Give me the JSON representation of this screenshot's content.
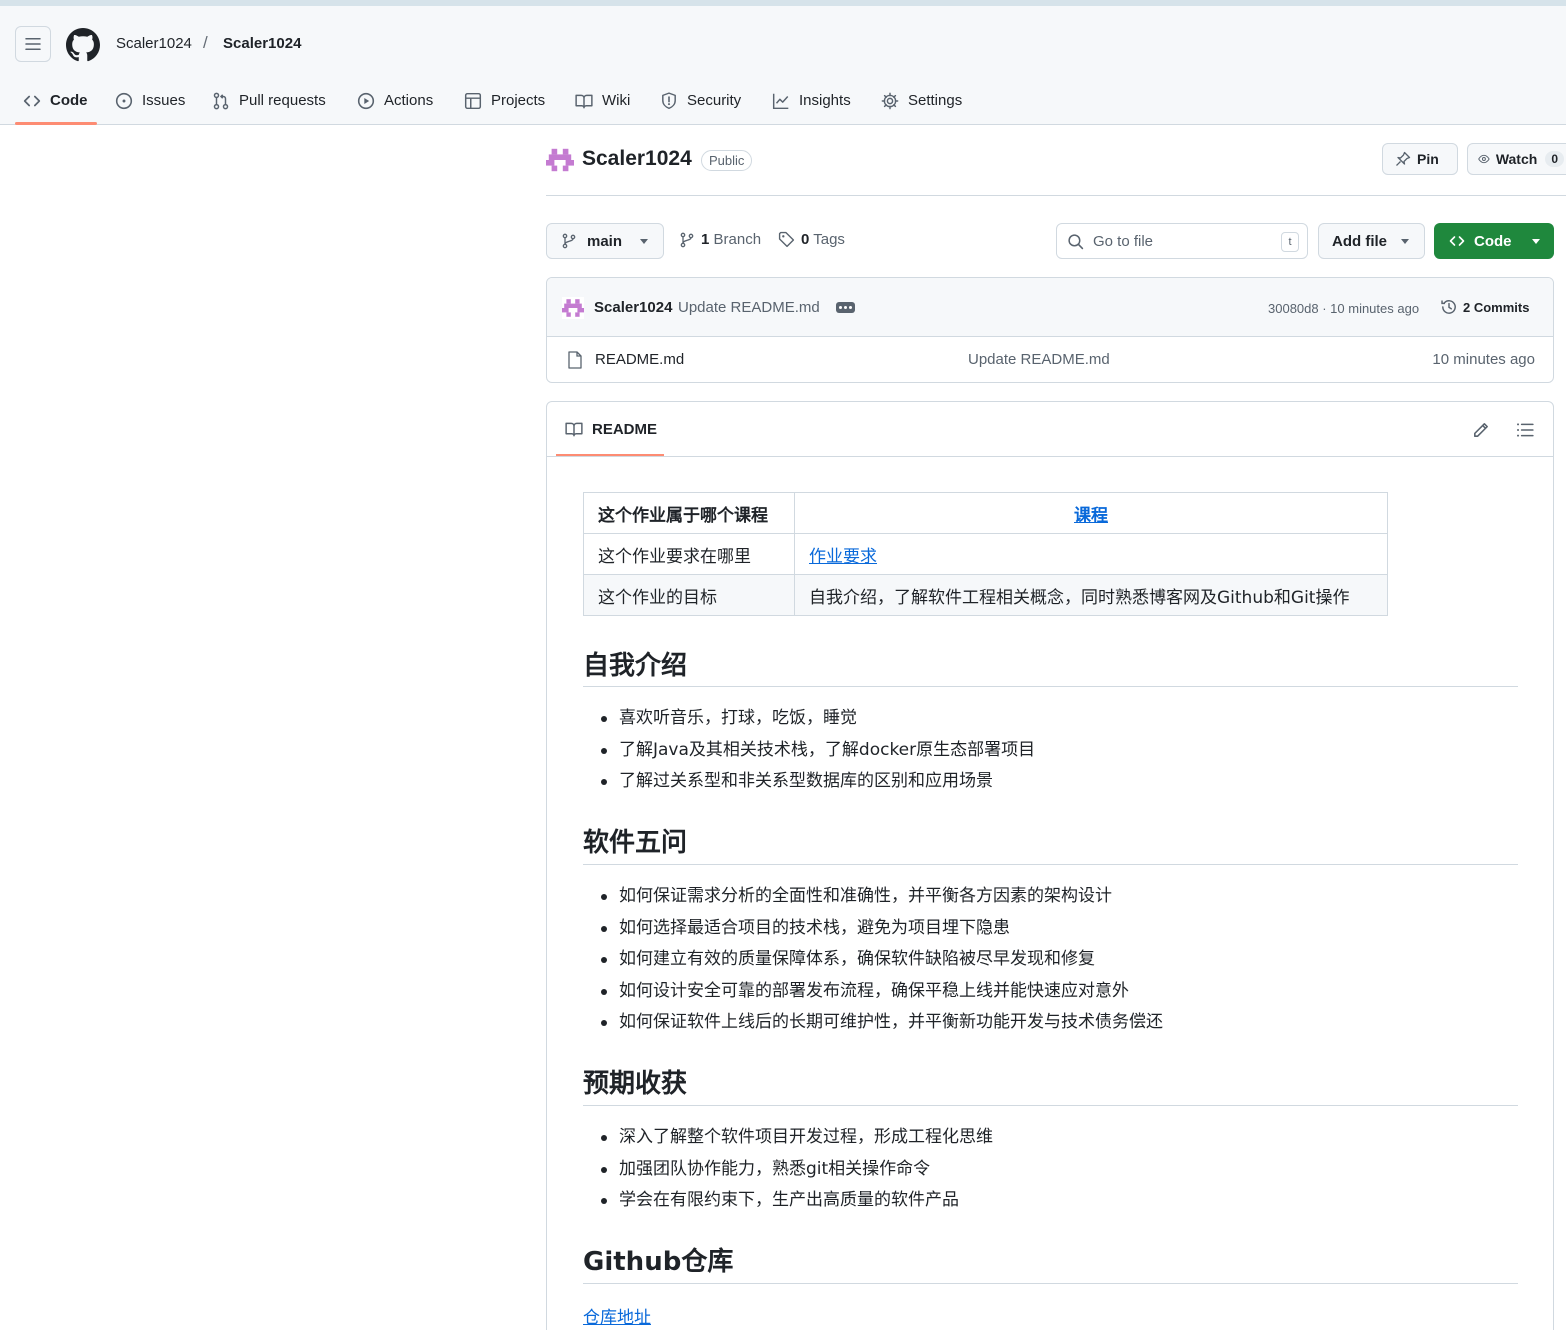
{
  "header": {
    "owner": "Scaler1024",
    "separator": "/",
    "repo": "Scaler1024"
  },
  "tabs": [
    {
      "label": "Code",
      "icon": "code-icon"
    },
    {
      "label": "Issues",
      "icon": "issue-icon"
    },
    {
      "label": "Pull requests",
      "icon": "pull-request-icon"
    },
    {
      "label": "Actions",
      "icon": "play-icon"
    },
    {
      "label": "Projects",
      "icon": "table-icon"
    },
    {
      "label": "Wiki",
      "icon": "book-icon"
    },
    {
      "label": "Security",
      "icon": "shield-icon"
    },
    {
      "label": "Insights",
      "icon": "graph-icon"
    },
    {
      "label": "Settings",
      "icon": "gear-icon"
    }
  ],
  "repo": {
    "name": "Scaler1024",
    "visibility": "Public",
    "pin_label": "Pin",
    "watch_label": "Watch",
    "watch_count": "0"
  },
  "toolbar": {
    "branch": "main",
    "branches_count": "1",
    "branches_label": "Branch",
    "tags_count": "0",
    "tags_label": "Tags",
    "search_placeholder": "Go to file",
    "search_kbd": "t",
    "add_file_label": "Add file",
    "code_label": "Code"
  },
  "latest_commit": {
    "author": "Scaler1024",
    "message": "Update README.md",
    "sha_time": "30080d8 · 10 minutes ago",
    "commits_label": "2 Commits"
  },
  "files": [
    {
      "name": "README.md",
      "message": "Update README.md",
      "time": "10 minutes ago"
    }
  ],
  "readme": {
    "tab_label": "README",
    "table": [
      {
        "label": "这个作业属于哪个课程",
        "value": "课程",
        "link": true,
        "bold": true
      },
      {
        "label": "这个作业要求在哪里",
        "value": "作业要求",
        "link": true,
        "bold": false
      },
      {
        "label": "这个作业的目标",
        "value": "自我介绍，了解软件工程相关概念，同时熟悉博客网及Github和Git操作",
        "link": false,
        "bold": false
      }
    ],
    "sections": [
      {
        "heading": "自我介绍",
        "items": [
          "喜欢听音乐，打球，吃饭，睡觉",
          "了解Java及其相关技术栈，了解docker原生态部署项目",
          "了解过关系型和非关系型数据库的区别和应用场景"
        ]
      },
      {
        "heading": "软件五问",
        "items": [
          "如何保证需求分析的全面性和准确性，并平衡各方因素的架构设计",
          "如何选择最适合项目的技术栈，避免为项目埋下隐患",
          "如何建立有效的质量保障体系，确保软件缺陷被尽早发现和修复",
          "如何设计安全可靠的部署发布流程，确保平稳上线并能快速应对意外",
          "如何保证软件上线后的长期可维护性，并平衡新功能开发与技术债务偿还"
        ]
      },
      {
        "heading": "预期收获",
        "items": [
          "深入了解整个软件项目开发过程，形成工程化思维",
          "加强团队协作能力，熟悉git相关操作命令",
          "学会在有限约束下，生产出高质量的软件产品"
        ]
      },
      {
        "heading": "Github仓库",
        "items": []
      }
    ],
    "repo_link": "仓库地址"
  }
}
